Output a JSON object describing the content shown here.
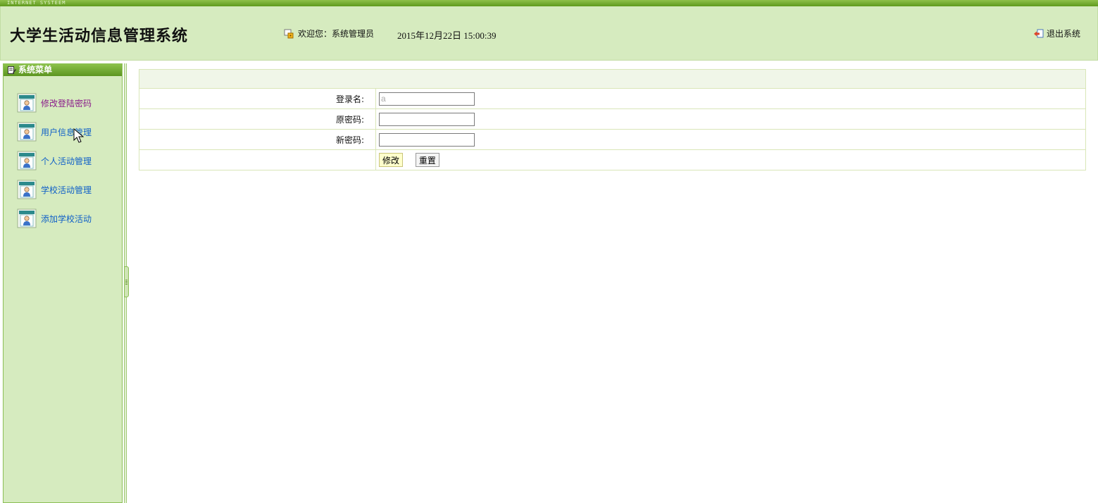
{
  "brand": {
    "strip_text": "INTERNET SYSTEEM"
  },
  "header": {
    "title": "大学生活动信息管理系统",
    "welcome": "欢迎您：系统管理员",
    "datetime": "2015年12月22日  15:00:39",
    "logout_label": "退出系统"
  },
  "sidebar": {
    "title": "系统菜单",
    "items": [
      {
        "label": "修改登陆密码",
        "icon": "user-card-icon",
        "active": true
      },
      {
        "label": "用户信息管理",
        "icon": "user-card-icon",
        "active": false
      },
      {
        "label": "个人活动管理",
        "icon": "user-card-icon",
        "active": false
      },
      {
        "label": "学校活动管理",
        "icon": "user-card-icon",
        "active": false
      },
      {
        "label": "添加学校活动",
        "icon": "user-card-icon",
        "active": false
      }
    ]
  },
  "form": {
    "login_label": "登录名:",
    "login_value": "a",
    "old_pwd_label": "原密码:",
    "old_pwd_value": "",
    "new_pwd_label": "新密码:",
    "new_pwd_value": "",
    "submit_label": "修改",
    "reset_label": "重置"
  },
  "colors": {
    "accent": "#6aa52a",
    "header_bg": "#d6ebbf",
    "link": "#1060c8",
    "active_link": "#8a1a8a"
  }
}
